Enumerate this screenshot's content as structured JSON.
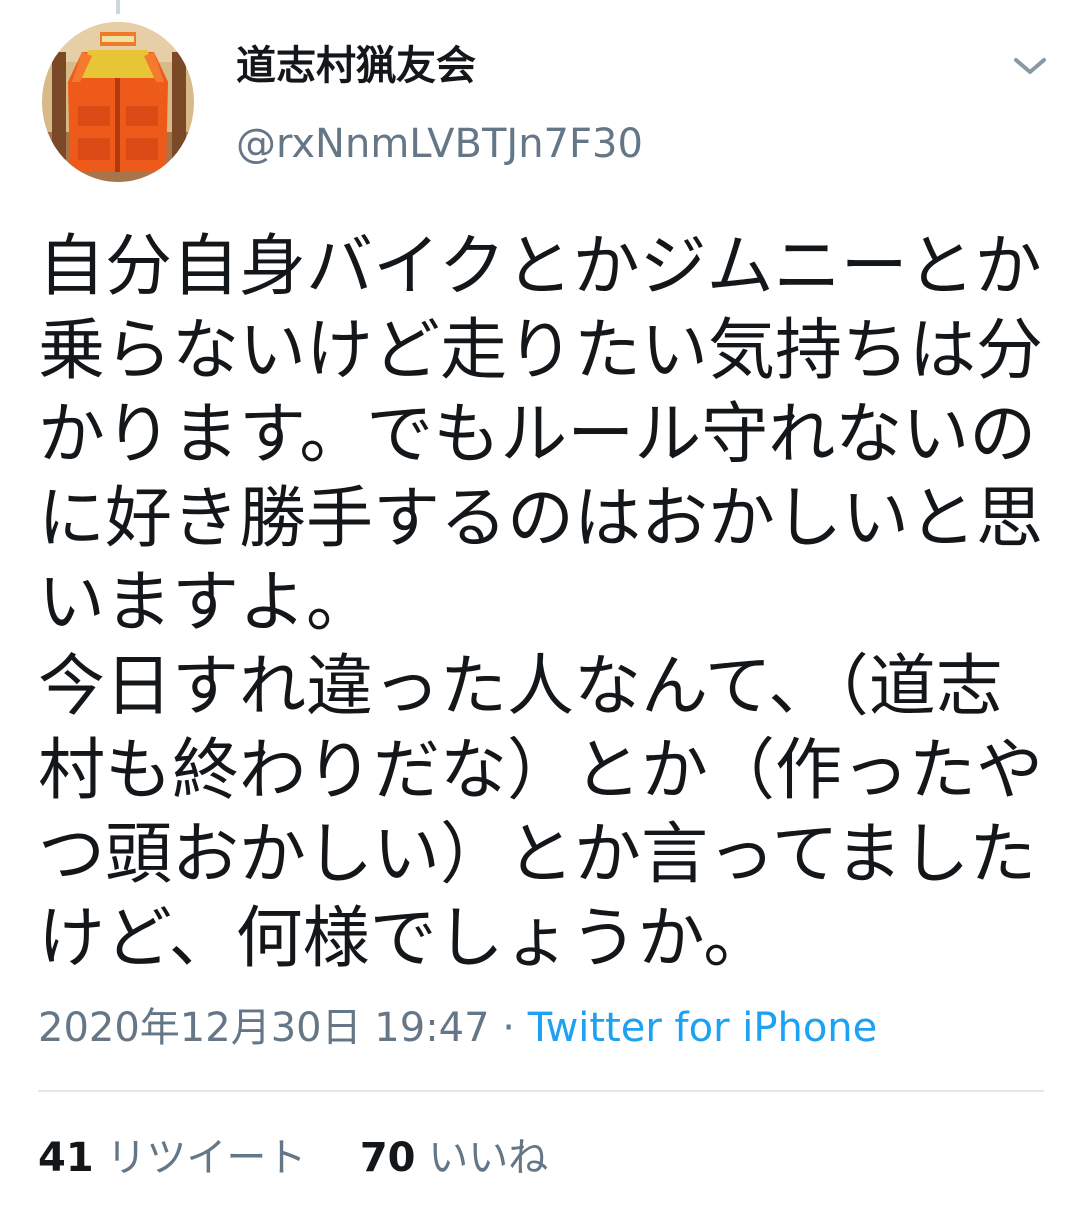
{
  "user": {
    "display_name": "道志村猟友会",
    "handle": "@rxNnmLVBTJn7F30",
    "avatar_icon": "orange-hunting-vest-avatar"
  },
  "tweet": {
    "lines": [
      "自分自身バイクとかジムニーとか",
      "乗らないけど走りたい気持ちは分",
      "かります。でもルール守れないの",
      "に好き勝手するのはおかしいと思",
      "いますよ。",
      "今日すれ違った人なんて、（道志",
      "村も終わりだな）とか（作ったや",
      "つ頭おかしい）とか言ってました",
      "けど、何様でしょうか。"
    ],
    "timestamp": "2020年12月30日 19:47",
    "separator": " · ",
    "source": "Twitter for iPhone"
  },
  "stats": {
    "retweets_count": "41",
    "retweets_label": "リツイート",
    "likes_count": "70",
    "likes_label": "いいね"
  },
  "colors": {
    "text": "#14171a",
    "secondary": "#657786",
    "link": "#1da1f2",
    "divider": "#e1e8ed"
  },
  "icons": {
    "menu": "chevron-down-icon"
  }
}
